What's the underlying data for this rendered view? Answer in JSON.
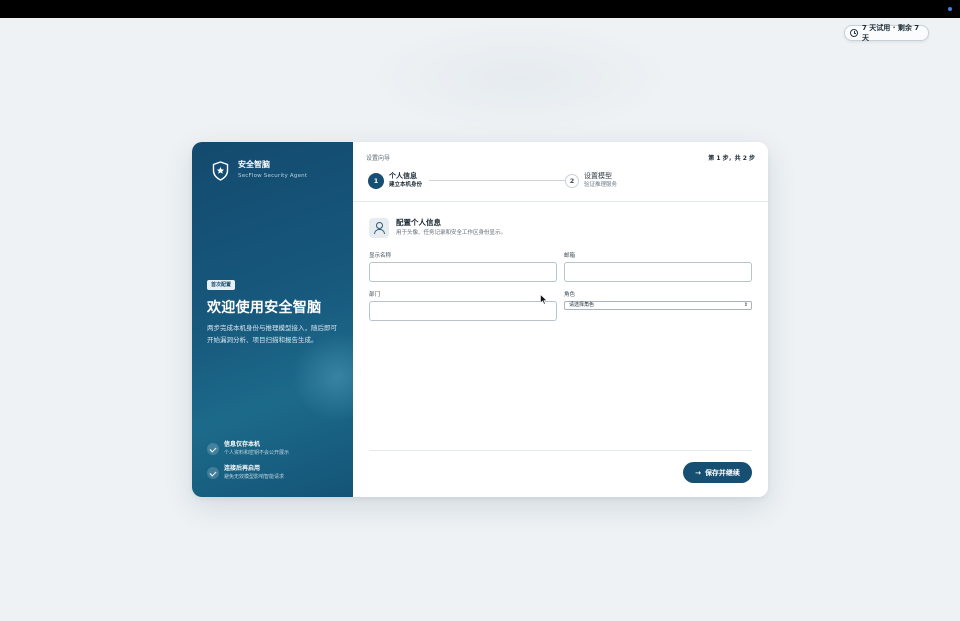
{
  "trial_badge": {
    "text": "7 天试用 · 剩余 7 天"
  },
  "brand": {
    "name": "安全智脑",
    "subtitle": "SecFlow Security Agent"
  },
  "intro": {
    "tag": "首次配置",
    "title": "欢迎使用安全智脑",
    "description": "两步完成本机身份与推理模型接入，随后即可开始漏洞分析、项目扫描和报告生成。"
  },
  "features": [
    {
      "title": "信息仅存本机",
      "desc": "个人资料和密钥不会公开展示"
    },
    {
      "title": "连接后再启用",
      "desc": "避免无效模型影响智能请求"
    }
  ],
  "wizard": {
    "label": "设置向导",
    "step_count": "第 1 步，共 2 步",
    "steps": [
      {
        "num": "1",
        "title": "个人信息",
        "sub": "建立本机身份"
      },
      {
        "num": "2",
        "title": "设置模型",
        "sub": "验证推理服务"
      }
    ]
  },
  "section": {
    "title": "配置个人信息",
    "desc": "用于头像、任务记录和安全工作区身份显示。"
  },
  "form": {
    "display_name_label": "显示名称",
    "display_name_value": "",
    "email_label": "邮箱",
    "email_value": "",
    "department_label": "部门",
    "department_value": "",
    "role_label": "角色",
    "role_selected": "请选择角色"
  },
  "actions": {
    "save_label": "保存并继续"
  },
  "colors": {
    "primary": "#164f72",
    "accent_panel": "#17587d",
    "background": "#eef2f5"
  }
}
